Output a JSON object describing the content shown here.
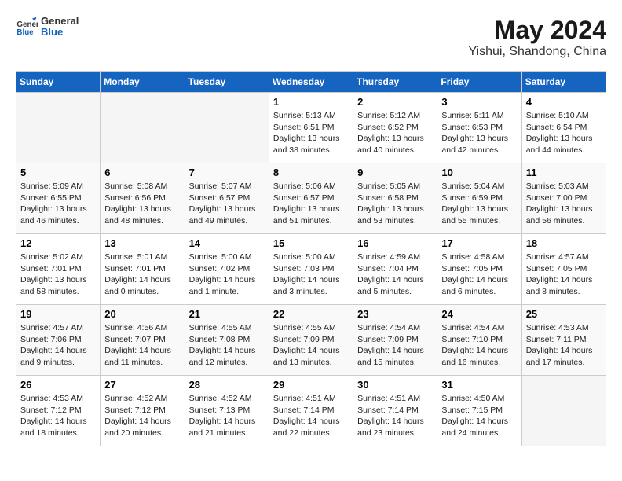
{
  "header": {
    "logo": {
      "general": "General",
      "blue": "Blue"
    },
    "title": "May 2024",
    "location": "Yishui, Shandong, China"
  },
  "days_of_week": [
    "Sunday",
    "Monday",
    "Tuesday",
    "Wednesday",
    "Thursday",
    "Friday",
    "Saturday"
  ],
  "weeks": [
    [
      {
        "day": "",
        "info": ""
      },
      {
        "day": "",
        "info": ""
      },
      {
        "day": "",
        "info": ""
      },
      {
        "day": "1",
        "info": "Sunrise: 5:13 AM\nSunset: 6:51 PM\nDaylight: 13 hours and 38 minutes."
      },
      {
        "day": "2",
        "info": "Sunrise: 5:12 AM\nSunset: 6:52 PM\nDaylight: 13 hours and 40 minutes."
      },
      {
        "day": "3",
        "info": "Sunrise: 5:11 AM\nSunset: 6:53 PM\nDaylight: 13 hours and 42 minutes."
      },
      {
        "day": "4",
        "info": "Sunrise: 5:10 AM\nSunset: 6:54 PM\nDaylight: 13 hours and 44 minutes."
      }
    ],
    [
      {
        "day": "5",
        "info": "Sunrise: 5:09 AM\nSunset: 6:55 PM\nDaylight: 13 hours and 46 minutes."
      },
      {
        "day": "6",
        "info": "Sunrise: 5:08 AM\nSunset: 6:56 PM\nDaylight: 13 hours and 48 minutes."
      },
      {
        "day": "7",
        "info": "Sunrise: 5:07 AM\nSunset: 6:57 PM\nDaylight: 13 hours and 49 minutes."
      },
      {
        "day": "8",
        "info": "Sunrise: 5:06 AM\nSunset: 6:57 PM\nDaylight: 13 hours and 51 minutes."
      },
      {
        "day": "9",
        "info": "Sunrise: 5:05 AM\nSunset: 6:58 PM\nDaylight: 13 hours and 53 minutes."
      },
      {
        "day": "10",
        "info": "Sunrise: 5:04 AM\nSunset: 6:59 PM\nDaylight: 13 hours and 55 minutes."
      },
      {
        "day": "11",
        "info": "Sunrise: 5:03 AM\nSunset: 7:00 PM\nDaylight: 13 hours and 56 minutes."
      }
    ],
    [
      {
        "day": "12",
        "info": "Sunrise: 5:02 AM\nSunset: 7:01 PM\nDaylight: 13 hours and 58 minutes."
      },
      {
        "day": "13",
        "info": "Sunrise: 5:01 AM\nSunset: 7:01 PM\nDaylight: 14 hours and 0 minutes."
      },
      {
        "day": "14",
        "info": "Sunrise: 5:00 AM\nSunset: 7:02 PM\nDaylight: 14 hours and 1 minute."
      },
      {
        "day": "15",
        "info": "Sunrise: 5:00 AM\nSunset: 7:03 PM\nDaylight: 14 hours and 3 minutes."
      },
      {
        "day": "16",
        "info": "Sunrise: 4:59 AM\nSunset: 7:04 PM\nDaylight: 14 hours and 5 minutes."
      },
      {
        "day": "17",
        "info": "Sunrise: 4:58 AM\nSunset: 7:05 PM\nDaylight: 14 hours and 6 minutes."
      },
      {
        "day": "18",
        "info": "Sunrise: 4:57 AM\nSunset: 7:05 PM\nDaylight: 14 hours and 8 minutes."
      }
    ],
    [
      {
        "day": "19",
        "info": "Sunrise: 4:57 AM\nSunset: 7:06 PM\nDaylight: 14 hours and 9 minutes."
      },
      {
        "day": "20",
        "info": "Sunrise: 4:56 AM\nSunset: 7:07 PM\nDaylight: 14 hours and 11 minutes."
      },
      {
        "day": "21",
        "info": "Sunrise: 4:55 AM\nSunset: 7:08 PM\nDaylight: 14 hours and 12 minutes."
      },
      {
        "day": "22",
        "info": "Sunrise: 4:55 AM\nSunset: 7:09 PM\nDaylight: 14 hours and 13 minutes."
      },
      {
        "day": "23",
        "info": "Sunrise: 4:54 AM\nSunset: 7:09 PM\nDaylight: 14 hours and 15 minutes."
      },
      {
        "day": "24",
        "info": "Sunrise: 4:54 AM\nSunset: 7:10 PM\nDaylight: 14 hours and 16 minutes."
      },
      {
        "day": "25",
        "info": "Sunrise: 4:53 AM\nSunset: 7:11 PM\nDaylight: 14 hours and 17 minutes."
      }
    ],
    [
      {
        "day": "26",
        "info": "Sunrise: 4:53 AM\nSunset: 7:12 PM\nDaylight: 14 hours and 18 minutes."
      },
      {
        "day": "27",
        "info": "Sunrise: 4:52 AM\nSunset: 7:12 PM\nDaylight: 14 hours and 20 minutes."
      },
      {
        "day": "28",
        "info": "Sunrise: 4:52 AM\nSunset: 7:13 PM\nDaylight: 14 hours and 21 minutes."
      },
      {
        "day": "29",
        "info": "Sunrise: 4:51 AM\nSunset: 7:14 PM\nDaylight: 14 hours and 22 minutes."
      },
      {
        "day": "30",
        "info": "Sunrise: 4:51 AM\nSunset: 7:14 PM\nDaylight: 14 hours and 23 minutes."
      },
      {
        "day": "31",
        "info": "Sunrise: 4:50 AM\nSunset: 7:15 PM\nDaylight: 14 hours and 24 minutes."
      },
      {
        "day": "",
        "info": ""
      }
    ]
  ]
}
